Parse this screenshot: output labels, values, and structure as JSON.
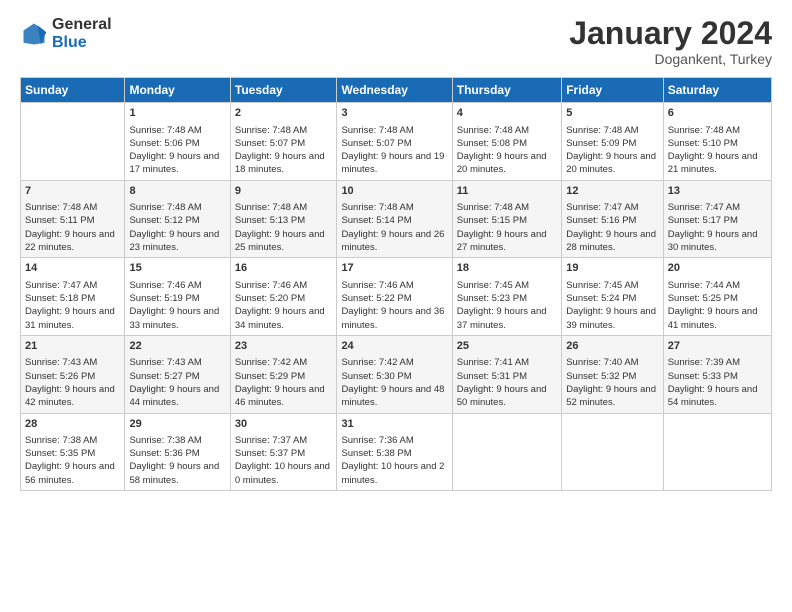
{
  "logo": {
    "general": "General",
    "blue": "Blue"
  },
  "title": "January 2024",
  "subtitle": "Dogankent, Turkey",
  "days_header": [
    "Sunday",
    "Monday",
    "Tuesday",
    "Wednesday",
    "Thursday",
    "Friday",
    "Saturday"
  ],
  "weeks": [
    [
      {
        "day": "",
        "sunrise": "",
        "sunset": "",
        "daylight": ""
      },
      {
        "day": "1",
        "sunrise": "Sunrise: 7:48 AM",
        "sunset": "Sunset: 5:06 PM",
        "daylight": "Daylight: 9 hours and 17 minutes."
      },
      {
        "day": "2",
        "sunrise": "Sunrise: 7:48 AM",
        "sunset": "Sunset: 5:07 PM",
        "daylight": "Daylight: 9 hours and 18 minutes."
      },
      {
        "day": "3",
        "sunrise": "Sunrise: 7:48 AM",
        "sunset": "Sunset: 5:07 PM",
        "daylight": "Daylight: 9 hours and 19 minutes."
      },
      {
        "day": "4",
        "sunrise": "Sunrise: 7:48 AM",
        "sunset": "Sunset: 5:08 PM",
        "daylight": "Daylight: 9 hours and 20 minutes."
      },
      {
        "day": "5",
        "sunrise": "Sunrise: 7:48 AM",
        "sunset": "Sunset: 5:09 PM",
        "daylight": "Daylight: 9 hours and 20 minutes."
      },
      {
        "day": "6",
        "sunrise": "Sunrise: 7:48 AM",
        "sunset": "Sunset: 5:10 PM",
        "daylight": "Daylight: 9 hours and 21 minutes."
      }
    ],
    [
      {
        "day": "7",
        "sunrise": "Sunrise: 7:48 AM",
        "sunset": "Sunset: 5:11 PM",
        "daylight": "Daylight: 9 hours and 22 minutes."
      },
      {
        "day": "8",
        "sunrise": "Sunrise: 7:48 AM",
        "sunset": "Sunset: 5:12 PM",
        "daylight": "Daylight: 9 hours and 23 minutes."
      },
      {
        "day": "9",
        "sunrise": "Sunrise: 7:48 AM",
        "sunset": "Sunset: 5:13 PM",
        "daylight": "Daylight: 9 hours and 25 minutes."
      },
      {
        "day": "10",
        "sunrise": "Sunrise: 7:48 AM",
        "sunset": "Sunset: 5:14 PM",
        "daylight": "Daylight: 9 hours and 26 minutes."
      },
      {
        "day": "11",
        "sunrise": "Sunrise: 7:48 AM",
        "sunset": "Sunset: 5:15 PM",
        "daylight": "Daylight: 9 hours and 27 minutes."
      },
      {
        "day": "12",
        "sunrise": "Sunrise: 7:47 AM",
        "sunset": "Sunset: 5:16 PM",
        "daylight": "Daylight: 9 hours and 28 minutes."
      },
      {
        "day": "13",
        "sunrise": "Sunrise: 7:47 AM",
        "sunset": "Sunset: 5:17 PM",
        "daylight": "Daylight: 9 hours and 30 minutes."
      }
    ],
    [
      {
        "day": "14",
        "sunrise": "Sunrise: 7:47 AM",
        "sunset": "Sunset: 5:18 PM",
        "daylight": "Daylight: 9 hours and 31 minutes."
      },
      {
        "day": "15",
        "sunrise": "Sunrise: 7:46 AM",
        "sunset": "Sunset: 5:19 PM",
        "daylight": "Daylight: 9 hours and 33 minutes."
      },
      {
        "day": "16",
        "sunrise": "Sunrise: 7:46 AM",
        "sunset": "Sunset: 5:20 PM",
        "daylight": "Daylight: 9 hours and 34 minutes."
      },
      {
        "day": "17",
        "sunrise": "Sunrise: 7:46 AM",
        "sunset": "Sunset: 5:22 PM",
        "daylight": "Daylight: 9 hours and 36 minutes."
      },
      {
        "day": "18",
        "sunrise": "Sunrise: 7:45 AM",
        "sunset": "Sunset: 5:23 PM",
        "daylight": "Daylight: 9 hours and 37 minutes."
      },
      {
        "day": "19",
        "sunrise": "Sunrise: 7:45 AM",
        "sunset": "Sunset: 5:24 PM",
        "daylight": "Daylight: 9 hours and 39 minutes."
      },
      {
        "day": "20",
        "sunrise": "Sunrise: 7:44 AM",
        "sunset": "Sunset: 5:25 PM",
        "daylight": "Daylight: 9 hours and 41 minutes."
      }
    ],
    [
      {
        "day": "21",
        "sunrise": "Sunrise: 7:43 AM",
        "sunset": "Sunset: 5:26 PM",
        "daylight": "Daylight: 9 hours and 42 minutes."
      },
      {
        "day": "22",
        "sunrise": "Sunrise: 7:43 AM",
        "sunset": "Sunset: 5:27 PM",
        "daylight": "Daylight: 9 hours and 44 minutes."
      },
      {
        "day": "23",
        "sunrise": "Sunrise: 7:42 AM",
        "sunset": "Sunset: 5:29 PM",
        "daylight": "Daylight: 9 hours and 46 minutes."
      },
      {
        "day": "24",
        "sunrise": "Sunrise: 7:42 AM",
        "sunset": "Sunset: 5:30 PM",
        "daylight": "Daylight: 9 hours and 48 minutes."
      },
      {
        "day": "25",
        "sunrise": "Sunrise: 7:41 AM",
        "sunset": "Sunset: 5:31 PM",
        "daylight": "Daylight: 9 hours and 50 minutes."
      },
      {
        "day": "26",
        "sunrise": "Sunrise: 7:40 AM",
        "sunset": "Sunset: 5:32 PM",
        "daylight": "Daylight: 9 hours and 52 minutes."
      },
      {
        "day": "27",
        "sunrise": "Sunrise: 7:39 AM",
        "sunset": "Sunset: 5:33 PM",
        "daylight": "Daylight: 9 hours and 54 minutes."
      }
    ],
    [
      {
        "day": "28",
        "sunrise": "Sunrise: 7:38 AM",
        "sunset": "Sunset: 5:35 PM",
        "daylight": "Daylight: 9 hours and 56 minutes."
      },
      {
        "day": "29",
        "sunrise": "Sunrise: 7:38 AM",
        "sunset": "Sunset: 5:36 PM",
        "daylight": "Daylight: 9 hours and 58 minutes."
      },
      {
        "day": "30",
        "sunrise": "Sunrise: 7:37 AM",
        "sunset": "Sunset: 5:37 PM",
        "daylight": "Daylight: 10 hours and 0 minutes."
      },
      {
        "day": "31",
        "sunrise": "Sunrise: 7:36 AM",
        "sunset": "Sunset: 5:38 PM",
        "daylight": "Daylight: 10 hours and 2 minutes."
      },
      {
        "day": "",
        "sunrise": "",
        "sunset": "",
        "daylight": ""
      },
      {
        "day": "",
        "sunrise": "",
        "sunset": "",
        "daylight": ""
      },
      {
        "day": "",
        "sunrise": "",
        "sunset": "",
        "daylight": ""
      }
    ]
  ]
}
